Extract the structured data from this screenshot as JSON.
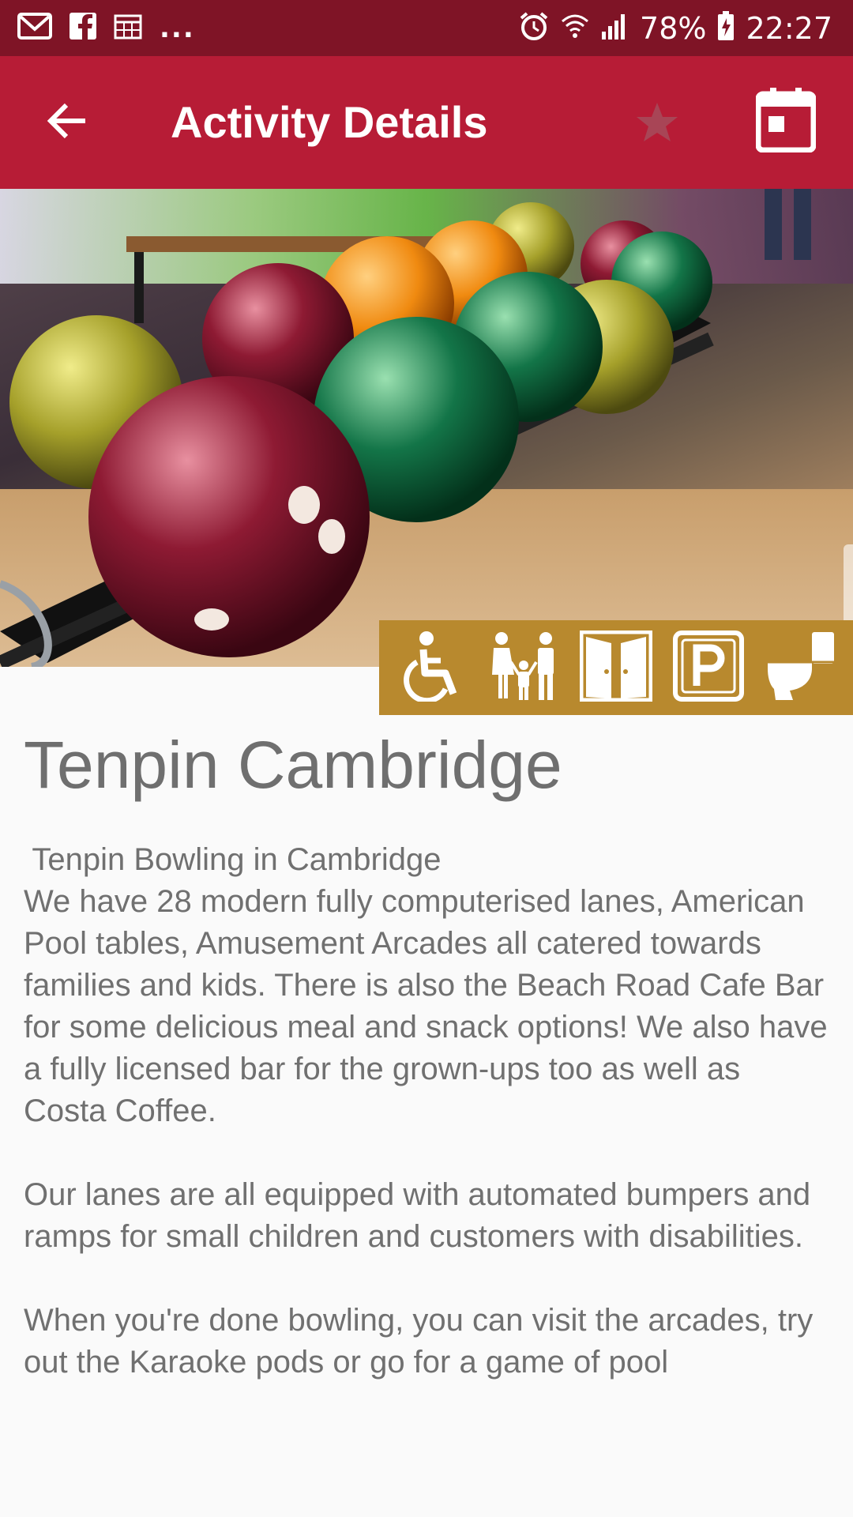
{
  "status_bar": {
    "icons": [
      "gmail-icon",
      "facebook-icon",
      "calendar-grid-icon"
    ],
    "overflow": "...",
    "battery": "78%",
    "time": "22:27"
  },
  "app_bar": {
    "title": "Activity Details",
    "back_icon": "arrow-left-icon",
    "favorite_icon": "star-icon",
    "calendar_icon": "calendar-icon",
    "background_color": "#b71c36"
  },
  "hero": {
    "icon": "bowling-balls-photo"
  },
  "amenities": [
    {
      "name": "wheelchair-accessible",
      "icon": "wheelchair-icon"
    },
    {
      "name": "family-friendly",
      "icon": "family-icon"
    },
    {
      "name": "indoor",
      "icon": "door-icon"
    },
    {
      "name": "parking",
      "icon": "parking-icon"
    },
    {
      "name": "toilets",
      "icon": "toilet-icon"
    }
  ],
  "amenity_color": "#b8892e",
  "venue": {
    "name": "Tenpin Cambridge",
    "subtitle": " Tenpin Bowling in Cambridge",
    "paragraphs": [
      "We have 28 modern fully computerised lanes, American Pool tables, Amusement Arcades all catered towards families and kids. There is also the Beach Road Cafe Bar for some delicious meal and snack options! We also have a fully licensed bar for the grown-ups too as well as Costa Coffee.",
      "Our lanes are all equipped with automated bumpers and ramps for small children and customers with disabilities.",
      "When you're done bowling, you can visit the arcades, try out the Karaoke pods or go for a game of pool"
    ]
  }
}
